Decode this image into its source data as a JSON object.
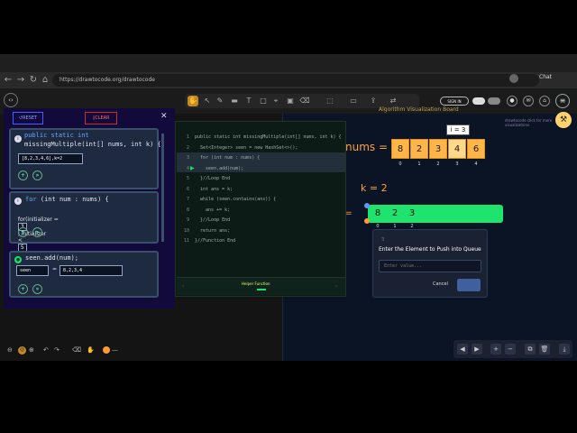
{
  "browser": {
    "url": "https://drawtocode.org/drawtocode",
    "chat_label": "Chat"
  },
  "app": {
    "brand_icon": "code-brackets-icon",
    "sign_in_label": "SIGN IN",
    "viz_title": "Algorithm Visualization Board",
    "viz_caption": "drawtocode click for more visualizations"
  },
  "left_panel": {
    "reset_label": "RESET",
    "clear_label": "CLEAR",
    "card1": {
      "signature_kw": "public static int",
      "signature": "missingMultiple(int[] nums, int k) {",
      "input_value": "8,2,3,4,6],k=2"
    },
    "card2": {
      "loop_kw": "for",
      "loop": "(int num : nums) {",
      "init_label": "for(initializer =",
      "init_value": "3",
      "cond_label": "; initializer",
      "cond_op": "<",
      "cond_value": "5",
      "step_sep": ";",
      "step_value": "1",
      "step_op": "++)"
    },
    "card3": {
      "statement": "seen.add(num);",
      "var_name": "seen",
      "var_eq": "=",
      "var_value": "8,2,3,4"
    }
  },
  "code": {
    "lines": [
      "public static int missingMultiple(int[] nums, int k) {",
      "  Set<Integer> seen = new HashSet<>();",
      "  for (int num : nums) {",
      "    seen.add(num);",
      "  }//Loop End",
      "  int ans = k;",
      "  while (seen.contains(ans)) {",
      "    ans += k;",
      "  }//Loop End",
      "  return ans;",
      "}//Function End"
    ],
    "footer_label": "Helper Function"
  },
  "viz": {
    "nums_label": "nums =",
    "nums": [
      "8",
      "2",
      "3",
      "4",
      "6"
    ],
    "indices": [
      "0",
      "1",
      "2",
      "3",
      "4"
    ],
    "pointer_label": "i = 3",
    "k_label": "k = 2",
    "eq_label": "=",
    "queue": [
      "8",
      "2",
      "3"
    ],
    "queue_indices": [
      "0",
      "1",
      "2"
    ]
  },
  "dialog": {
    "title": "Enter the Element to Push into Queue",
    "placeholder": "Enter value...",
    "cancel_label": "Cancel"
  },
  "colors": {
    "array_cell": "#ffb547",
    "queue_fill": "#1ee36c",
    "accent_green": "#19e36b",
    "panel_bg": "#120a3a"
  }
}
